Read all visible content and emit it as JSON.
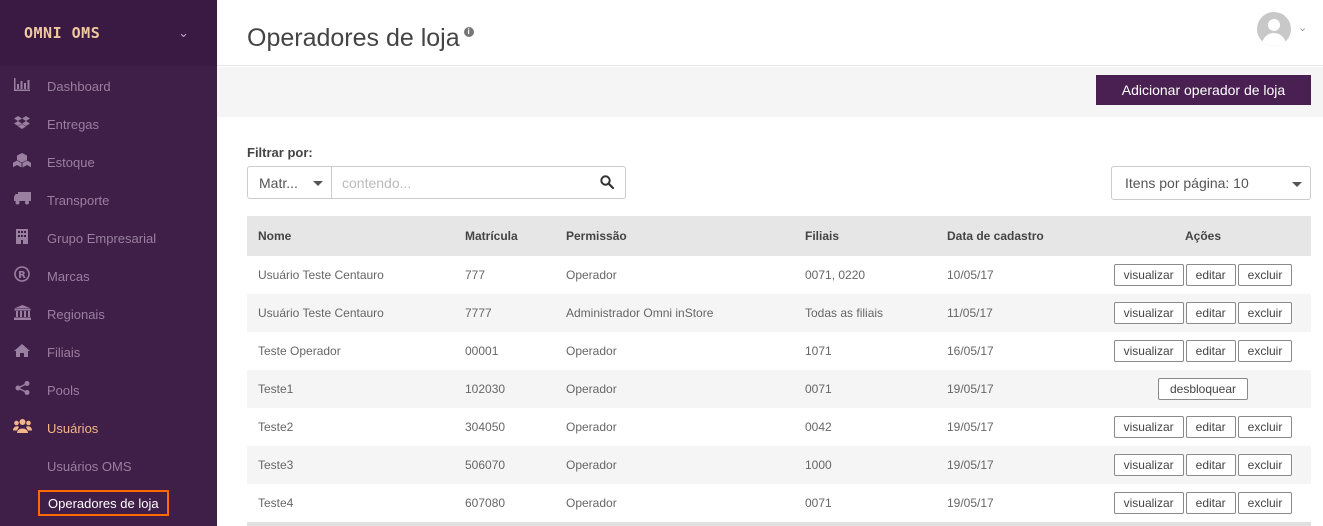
{
  "brand": {
    "name": "OMNI OMS"
  },
  "sidebar": {
    "items": [
      {
        "label": "Dashboard",
        "icon": "bar-chart-icon"
      },
      {
        "label": "Entregas",
        "icon": "dropbox-icon"
      },
      {
        "label": "Estoque",
        "icon": "cubes-icon"
      },
      {
        "label": "Transporte",
        "icon": "truck-icon"
      },
      {
        "label": "Grupo Empresarial",
        "icon": "building-icon"
      },
      {
        "label": "Marcas",
        "icon": "registered-icon"
      },
      {
        "label": "Regionais",
        "icon": "institution-icon"
      },
      {
        "label": "Filiais",
        "icon": "home-icon"
      },
      {
        "label": "Pools",
        "icon": "share-icon"
      },
      {
        "label": "Usuários",
        "icon": "users-icon",
        "active": true
      }
    ],
    "subitems": [
      {
        "label": "Usuários OMS"
      },
      {
        "label": "Operadores de loja",
        "active": true
      }
    ]
  },
  "header": {
    "title": "Operadores de loja",
    "info": "i"
  },
  "toolbar": {
    "add_label": "Adicionar operador de loja"
  },
  "filter": {
    "label": "Filtrar por:",
    "select_value": "Matr...",
    "placeholder": "contendo...",
    "per_page": "Itens por página: 10"
  },
  "table": {
    "headers": [
      "Nome",
      "Matrícula",
      "Permissão",
      "Filiais",
      "Data de cadastro",
      "Ações"
    ],
    "rows": [
      {
        "nome": "Usuário Teste Centauro",
        "matricula": "777",
        "permissao": "Operador",
        "filiais": "0071, 0220",
        "data": "10/05/17",
        "acoes": [
          "visualizar",
          "editar",
          "excluir"
        ]
      },
      {
        "nome": "Usuário Teste Centauro",
        "matricula": "7777",
        "permissao": "Administrador Omni inStore",
        "filiais": "Todas as filiais",
        "data": "11/05/17",
        "acoes": [
          "visualizar",
          "editar",
          "excluir"
        ]
      },
      {
        "nome": "Teste Operador",
        "matricula": "00001",
        "permissao": "Operador",
        "filiais": "1071",
        "data": "16/05/17",
        "acoes": [
          "visualizar",
          "editar",
          "excluir"
        ]
      },
      {
        "nome": "Teste1",
        "matricula": "102030",
        "permissao": "Operador",
        "filiais": "0071",
        "data": "19/05/17",
        "acoes": [
          "desbloquear"
        ]
      },
      {
        "nome": "Teste2",
        "matricula": "304050",
        "permissao": "Operador",
        "filiais": "0042",
        "data": "19/05/17",
        "acoes": [
          "visualizar",
          "editar",
          "excluir"
        ]
      },
      {
        "nome": "Teste3",
        "matricula": "506070",
        "permissao": "Operador",
        "filiais": "1000",
        "data": "19/05/17",
        "acoes": [
          "visualizar",
          "editar",
          "excluir"
        ]
      },
      {
        "nome": "Teste4",
        "matricula": "607080",
        "permissao": "Operador",
        "filiais": "0071",
        "data": "19/05/17",
        "acoes": [
          "visualizar",
          "editar",
          "excluir"
        ]
      }
    ]
  }
}
